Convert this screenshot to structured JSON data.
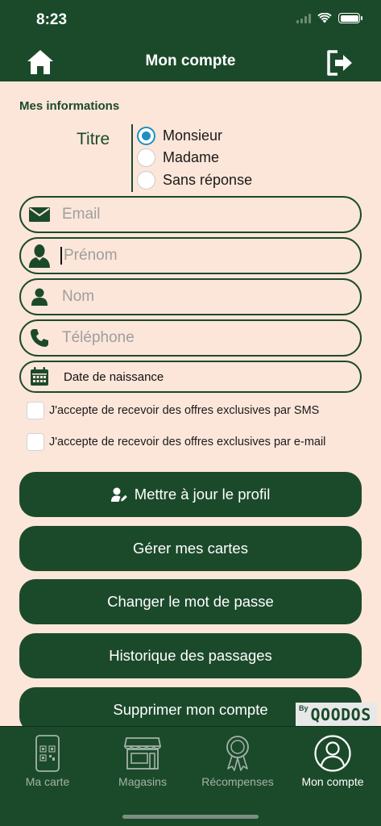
{
  "status_bar": {
    "time": "8:23"
  },
  "header": {
    "title": "Mon compte"
  },
  "section": {
    "title": "Mes informations"
  },
  "titre": {
    "label": "Titre",
    "options": [
      {
        "label": "Monsieur",
        "selected": true
      },
      {
        "label": "Madame",
        "selected": false
      },
      {
        "label": "Sans réponse",
        "selected": false
      }
    ]
  },
  "fields": {
    "email": {
      "placeholder": "Email",
      "icon": "envelope-icon"
    },
    "prenom": {
      "placeholder": "Prénom",
      "icon": "person-bust-icon"
    },
    "nom": {
      "placeholder": "Nom",
      "icon": "person-icon"
    },
    "telephone": {
      "placeholder": "Téléphone",
      "icon": "phone-icon"
    },
    "birthdate": {
      "placeholder": "Date de naissance",
      "icon": "calendar-icon"
    }
  },
  "checkboxes": {
    "sms": {
      "label": "J'accepte de recevoir des offres exclusives par SMS",
      "checked": false
    },
    "email": {
      "label": "J'accepte de recevoir des offres exclusives par e-mail",
      "checked": false
    }
  },
  "buttons": {
    "update_profile": "Mettre à jour le profil",
    "manage_cards": "Gérer mes cartes",
    "change_password": "Changer le mot de passe",
    "history": "Historique des passages",
    "delete_account": "Supprimer mon compte"
  },
  "brand": {
    "by": "By",
    "name": "QOODOS"
  },
  "tabs": [
    {
      "label": "Ma carte",
      "icon": "qr-card-icon",
      "active": false
    },
    {
      "label": "Magasins",
      "icon": "store-icon",
      "active": false
    },
    {
      "label": "Récompenses",
      "icon": "award-icon",
      "active": false
    },
    {
      "label": "Mon compte",
      "icon": "account-icon",
      "active": true
    }
  ],
  "colors": {
    "primary": "#1b4a2b",
    "background": "#fce6d9",
    "radio_accent": "#1f8fc0"
  }
}
